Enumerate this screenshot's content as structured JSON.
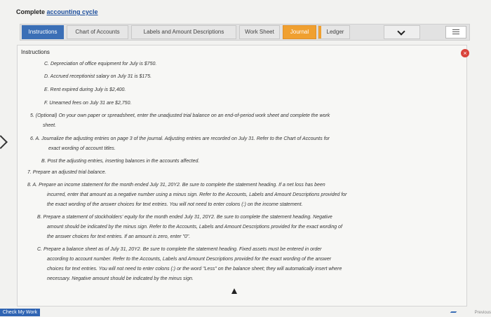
{
  "header": {
    "title_prefix": "Complete",
    "title_link": "accounting cycle"
  },
  "tabs": [
    {
      "label": "Instructions"
    },
    {
      "label": "Chart of Accounts"
    },
    {
      "label": "Labels and Amount Descriptions"
    },
    {
      "label": "Work Sheet"
    },
    {
      "label": "Journal"
    },
    {
      "label": "Ledger"
    }
  ],
  "panel": {
    "title": "Instructions"
  },
  "lines": [
    "C. Depreciation of office equipment for July is $750.",
    "D. Accrued receptionist salary on July 31 is $175.",
    "E. Rent expired during July is $2,400.",
    "F. Unearned fees on July 31 are $2,750.",
    "5.  (Optional) On your own paper or spreadsheet, enter the unadjusted trial balance on an end-of-period work sheet and complete the work",
    "sheet.",
    "6.  A. Journalize the adjusting entries on page 3 of the journal. Adjusting entries are recorded on July 31. Refer to the Chart of Accounts for",
    "exact wording of account titles.",
    "B. Post the adjusting entries, inserting balances in the accounts affected.",
    "7.  Prepare an adjusted trial balance.",
    "8.  A. Prepare an income statement for the month ended July 31, 20Y2. Be sure to complete the statement heading. If a net loss has been",
    "incurred, enter that amount as a negative number using a minus sign. Refer to the Accounts, Labels and Amount Descriptions provided for",
    "the exact wording of the answer choices for text entries. You will not need to enter colons (:) on the income statement.",
    "B. Prepare a statement of stockholders' equity for the month ended July 31, 20Y2. Be sure to complete the statement heading. Negative",
    "amount should be indicated by the minus sign. Refer to the Accounts, Labels and Amount Descriptions provided for the exact wording of",
    "the answer choices for text entries. If an amount is zero, enter \"0\".",
    "C. Prepare a balance sheet as of July 31, 20Y2. Be sure to complete the statement heading. Fixed assets must be entered in order",
    "according to account number. Refer to the Accounts, Labels and Amount Descriptions provided for the exact wording of the answer",
    "choices for text entries. You will not need to enter colons (:) or the word \"Less\" on the balance sheet; they will automatically insert where",
    "necessary. Negative amount should be indicated by the minus sign."
  ],
  "footer": {
    "check_label": "Check My Work",
    "corner_label": "Previous"
  }
}
